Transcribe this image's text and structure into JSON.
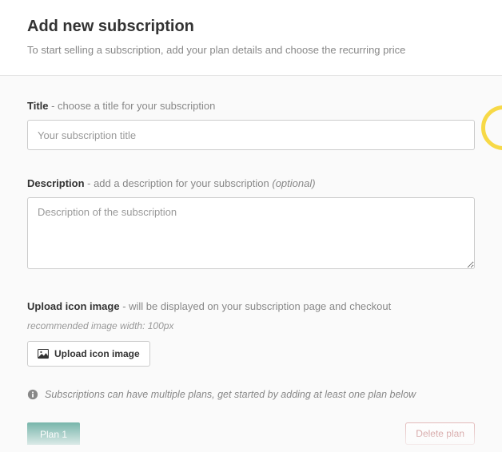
{
  "header": {
    "title": "Add new subscription",
    "subtitle": "To start selling a subscription, add your plan details and choose the recurring price"
  },
  "title_field": {
    "label_bold": "Title",
    "label_hint": " - choose a title for your subscription",
    "placeholder": "Your subscription title"
  },
  "description_field": {
    "label_bold": "Description",
    "label_hint": " - add a description for your subscription ",
    "optional": "(optional)",
    "placeholder": "Description of the subscription"
  },
  "upload_field": {
    "label_bold": "Upload icon image",
    "label_hint": " - will be displayed on your subscription page and checkout",
    "recommended": "recommended image width: 100px",
    "button_label": "Upload icon image"
  },
  "plans_info": "Subscriptions can have multiple plans, get started by adding at least one plan below",
  "plan_tab": "Plan 1",
  "delete_plan": "Delete plan"
}
